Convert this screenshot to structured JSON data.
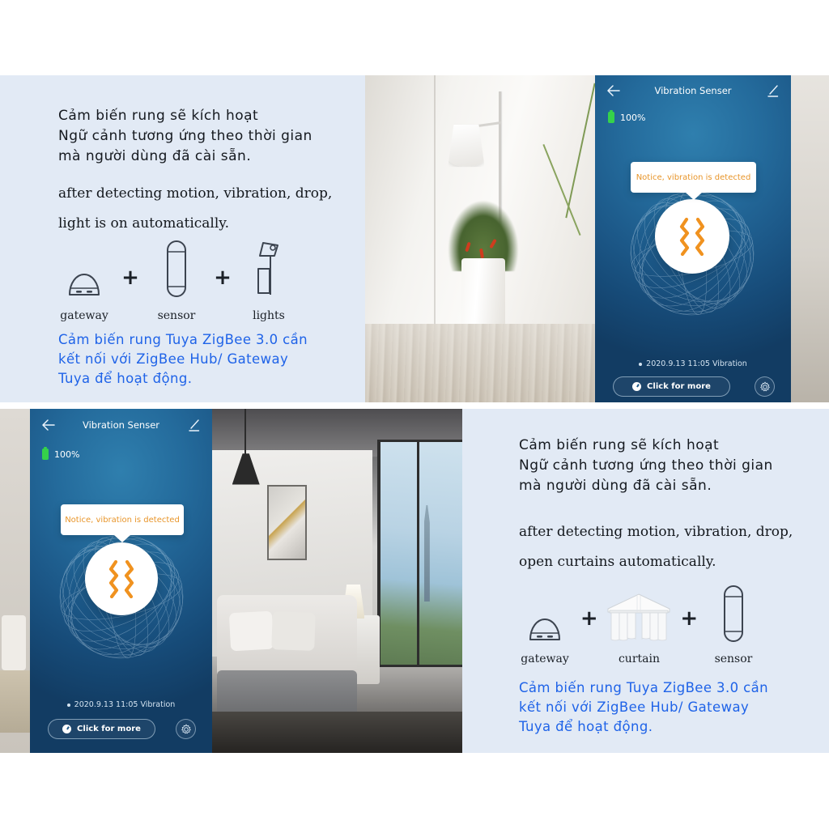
{
  "page": {
    "background": "#ffffff",
    "panel_background": "#e2eaf5",
    "accent_blue": "#1f63e8",
    "app_orange": "#e8952a",
    "battery_green": "#35d24a"
  },
  "top_left_info": {
    "vn_heading_lines": [
      "Cảm biến rung sẽ kích hoạt",
      "Ngữ cảnh tương ứng theo thời gian",
      "mà người dùng đã cài sẵn."
    ],
    "en_lines": [
      "after detecting motion, vibration, drop,",
      "light is on automatically."
    ],
    "icons": [
      {
        "name": "gateway-icon",
        "caption": "gateway"
      },
      {
        "name": "plus-sign",
        "caption": ""
      },
      {
        "name": "sensor-icon",
        "caption": "sensor"
      },
      {
        "name": "plus-sign",
        "caption": ""
      },
      {
        "name": "lights-icon",
        "caption": "lights"
      }
    ],
    "captions": {
      "gateway": "gateway",
      "sensor": "sensor",
      "lights": "lights",
      "plus": "+"
    },
    "note_lines": [
      "Cảm biến rung Tuya ZigBee 3.0 cần",
      "kết nối với ZigBee Hub/ Gateway",
      "Tuya để hoạt động."
    ]
  },
  "bottom_right_info": {
    "vn_heading_lines": [
      "Cảm biến rung sẽ kích hoạt",
      "Ngữ cảnh tương ứng theo thời gian",
      "mà người dùng đã cài sẵn."
    ],
    "en_lines": [
      "after detecting motion, vibration, drop,",
      "open curtains automatically."
    ],
    "icons": [
      {
        "name": "gateway-icon",
        "caption": "gateway"
      },
      {
        "name": "plus-sign",
        "caption": ""
      },
      {
        "name": "curtain-icon",
        "caption": "curtain"
      },
      {
        "name": "plus-sign",
        "caption": ""
      },
      {
        "name": "sensor-icon",
        "caption": "sensor"
      }
    ],
    "captions": {
      "gateway": "gateway",
      "curtain": "curtain",
      "sensor": "sensor",
      "plus": "+"
    },
    "note_lines": [
      "Cảm biến rung Tuya ZigBee 3.0 cần",
      "kết nối với ZigBee Hub/ Gateway",
      "Tuya để hoạt động."
    ]
  },
  "phone_app_top": {
    "title": "Vibration Senser",
    "back_icon": "back-arrow-icon",
    "edit_icon": "pencil-edit-icon",
    "battery_level": "100%",
    "notice_text": "Notice, vibration is detected",
    "status_icon": "vibration-waves-icon",
    "log_entry": "2020.9.13 11:05 Vibration",
    "click_more_label": "Click for more",
    "click_more_icon": "clock-icon",
    "settings_icon": "gear-icon"
  },
  "phone_app_bottom": {
    "title": "Vibration Senser",
    "back_icon": "back-arrow-icon",
    "edit_icon": "pencil-edit-icon",
    "battery_level": "100%",
    "notice_text": "Notice, vibration is detected",
    "status_icon": "vibration-waves-icon",
    "log_entry": "2020.9.13 11:05 Vibration",
    "click_more_label": "Click for more",
    "click_more_icon": "clock-icon",
    "settings_icon": "gear-icon"
  },
  "photos": {
    "top_middle": "indoor-plant-with-floor-lamp-photo",
    "bottom_middle": "modern-bedroom-with-window-photo",
    "bottom_left_side": "living-room-side-photo",
    "top_right_side": "wall-corner-side-photo"
  }
}
